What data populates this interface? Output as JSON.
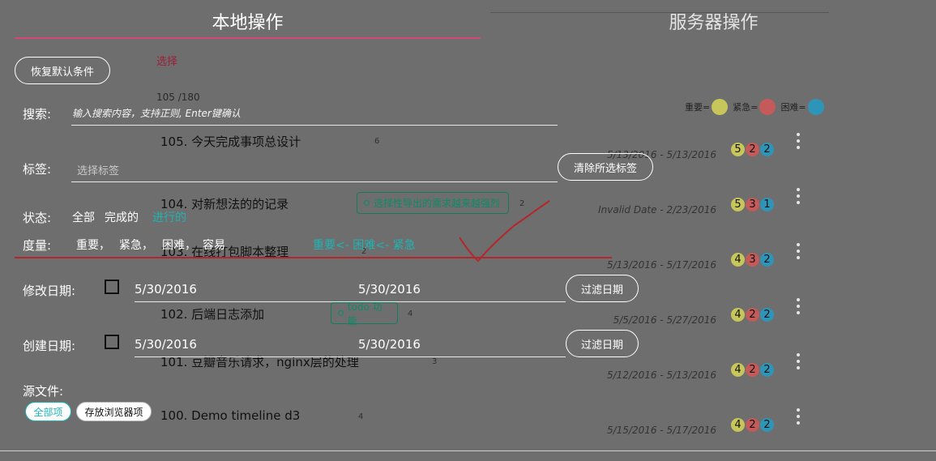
{
  "tabs": {
    "local": "本地操作",
    "server": "服务器操作"
  },
  "filters": {
    "reset_label": "恢复默认条件",
    "search_label": "搜索:",
    "search_placeholder": "输入搜索内容，支持正则, Enter键确认",
    "tag_label": "标签:",
    "tag_placeholder": "选择标签",
    "clear_tags_label": "清除所选标签",
    "status_label": "状态:",
    "status_options": [
      "全部",
      "完成的",
      "进行的"
    ],
    "measure_label": "度量:",
    "measure_options": [
      "重要，",
      "紧急，",
      "困难，",
      "容易"
    ],
    "sort_order": "重要<- 困难<- 紧急",
    "modified_label": "修改日期:",
    "modified_from": "5/30/2016",
    "modified_to": "5/30/2016",
    "created_label": "创建日期:",
    "created_from": "5/30/2016",
    "created_to": "5/30/2016",
    "filter_date_label": "过滤日期",
    "source_label": "源文件:",
    "source_all": "全部项",
    "source_browser": "存放浏览器项"
  },
  "list": {
    "select_label": "选择",
    "count": "105 /180",
    "legend": {
      "important": "重要=",
      "urgent": "紧急=",
      "difficult": "困难="
    },
    "tasks": [
      {
        "title": "105. 今天完成事项总设计",
        "count": "6",
        "date": "5/13/2016 - 5/13/2016",
        "badges": [
          "5",
          "2",
          "2"
        ]
      },
      {
        "title": "104. 对新想法的的记录",
        "tag": "选择性导出的需求越来越强烈",
        "count": "2",
        "date": "Invalid Date - 2/23/2016",
        "badges": [
          "5",
          "3",
          "1"
        ]
      },
      {
        "title": "103. 在线打包脚本整理",
        "count": "2",
        "date": "5/13/2016 - 5/17/2016",
        "badges": [
          "4",
          "3",
          "2"
        ]
      },
      {
        "title": "102. 后端日志添加",
        "tag": "todo 功能",
        "count": "4",
        "date": "5/5/2016 - 5/27/2016",
        "badges": [
          "4",
          "2",
          "2"
        ]
      },
      {
        "title": "101. 豆瓣音乐请求，nginx层的处理",
        "count": "3",
        "date": "5/12/2016 - 5/13/2016",
        "badges": [
          "4",
          "2",
          "2"
        ]
      },
      {
        "title": "100. Demo timeline d3",
        "count": "4",
        "date": "5/15/2016 - 5/17/2016",
        "badges": [
          "4",
          "2",
          "2"
        ]
      }
    ]
  },
  "colors": {
    "important": "#c6c65a",
    "urgent": "#c45a5a",
    "difficult": "#2e95b8",
    "accent": "#d9447a",
    "active": "#1fb4b4"
  }
}
